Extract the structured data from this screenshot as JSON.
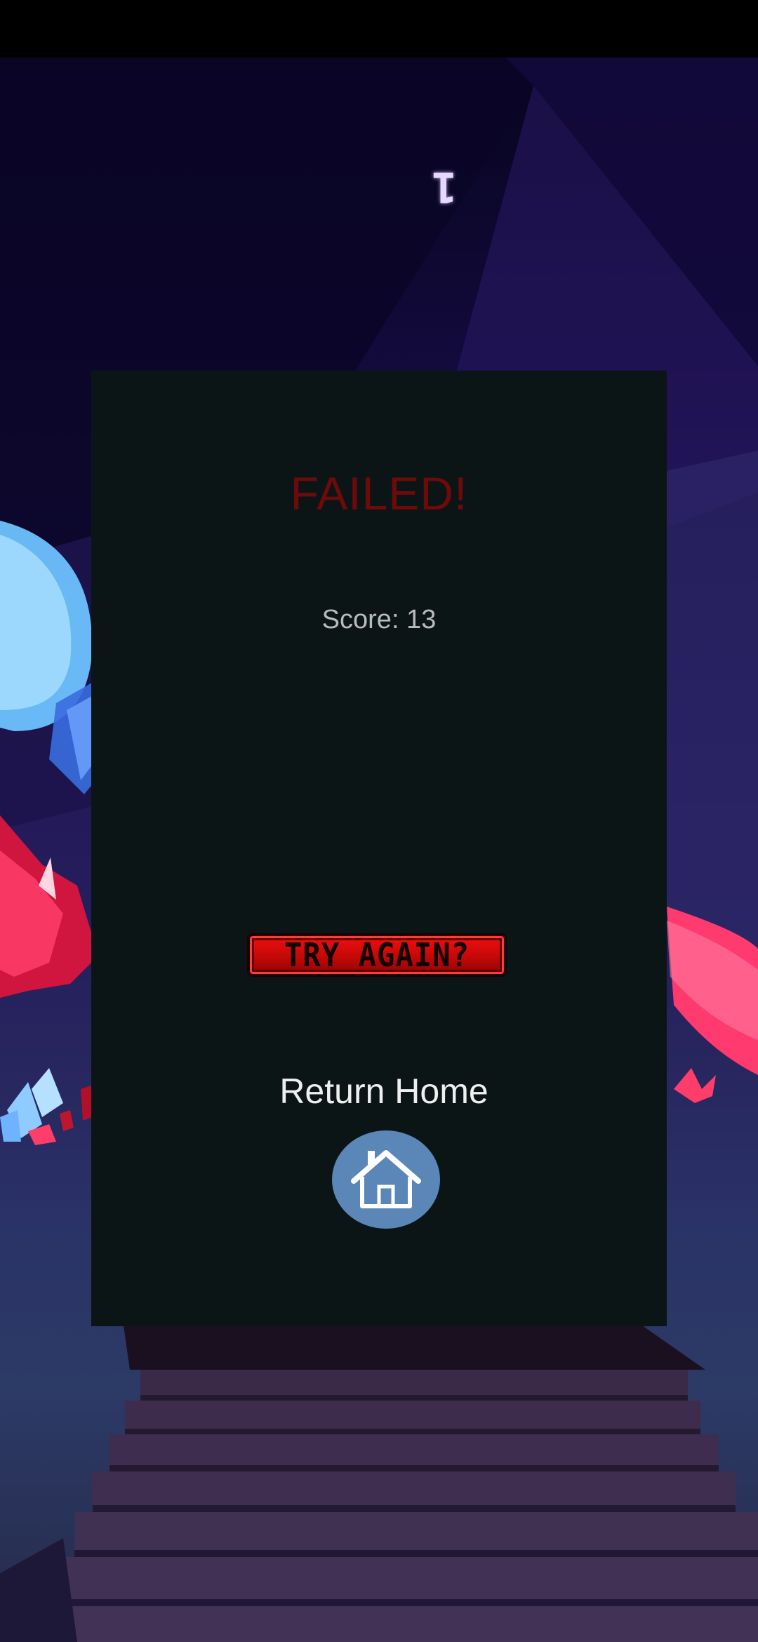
{
  "hud": {
    "score_marker": "1"
  },
  "dialog": {
    "title": "FAILED!",
    "score_text": "Score: 13",
    "try_again_label": "TRY AGAIN?",
    "return_home_label": "Return Home",
    "home_icon": "home-icon"
  },
  "colors": {
    "panel_background": "#0c1516",
    "title": "#6e0a0a",
    "try_again": "#e00e0e",
    "home_button": "#5b86b8"
  }
}
